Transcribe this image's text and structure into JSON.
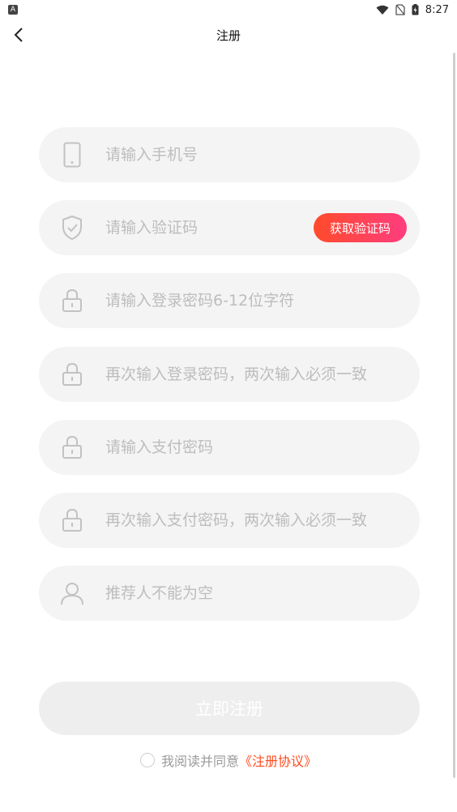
{
  "status_bar": {
    "time": "8:27",
    "app_badge": "A"
  },
  "header": {
    "title": "注册"
  },
  "fields": [
    {
      "placeholder": "请输入手机号",
      "icon": "phone-icon"
    },
    {
      "placeholder": "请输入验证码",
      "icon": "shield-check-icon",
      "action_label": "获取验证码"
    },
    {
      "placeholder": "请输入登录密码6-12位字符",
      "icon": "lock-icon"
    },
    {
      "placeholder": "再次输入登录密码，两次输入必须一致",
      "icon": "lock-icon"
    },
    {
      "placeholder": "请输入支付密码",
      "icon": "lock-icon"
    },
    {
      "placeholder": "再次输入支付密码，两次输入必须一致",
      "icon": "lock-icon"
    },
    {
      "placeholder": "推荐人不能为空",
      "icon": "user-icon"
    }
  ],
  "submit": {
    "label": "立即注册"
  },
  "agreement": {
    "text": "我阅读并同意",
    "link": "《注册协议》"
  },
  "colors": {
    "accent_start": "#ff4b2b",
    "accent_end": "#ff3d7f",
    "link": "#ff4b1f",
    "field_bg": "#f4f4f4",
    "placeholder": "#bdbdbd",
    "icon": "#c2c2c2"
  }
}
